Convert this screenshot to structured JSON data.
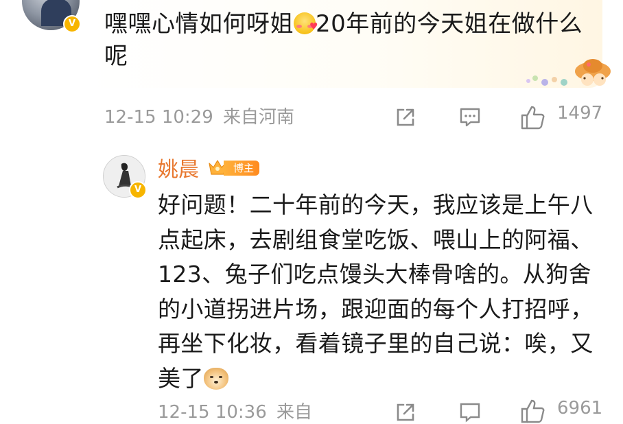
{
  "comment": {
    "text_before_emoji": "嘿嘿心情如何呀姐",
    "emoji": "smile-blush-emoji",
    "text_after_emoji": "20年前的今天姐在做什么呢",
    "meta": {
      "date": "12-15",
      "time": "10:29",
      "location": "来自河南",
      "like_count": "1497"
    }
  },
  "reply": {
    "author": "姚晨",
    "badge": "博主",
    "text": "好问题！二十年前的今天，我应该是上午八点起床，去剧组食堂吃饭、喂山上的阿福、123、兔子们吃点馒头大棒骨啥的。从狗舍的小道拐进片场，跟迎面的每个人打招呼，再坐下化妆，看着镜子里的自己说：唉，又美了",
    "emoji": "doge-emoji",
    "meta": {
      "date": "12-15",
      "time": "10:36",
      "location": "来自",
      "like_count": "6961"
    }
  },
  "colors": {
    "name": "#e8772e",
    "meta": "#9a9a9a",
    "badge": "#ff9a2a",
    "verified": "#f7b500"
  }
}
